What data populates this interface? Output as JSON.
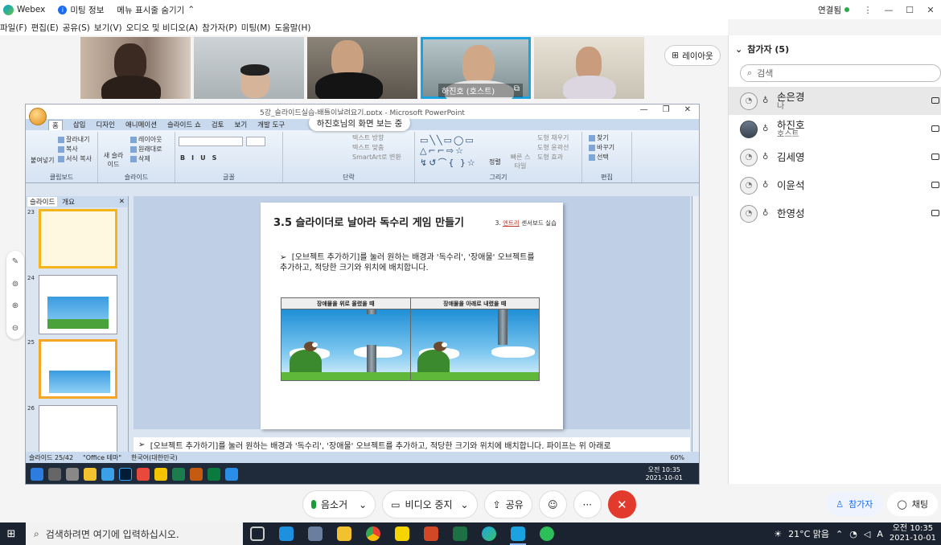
{
  "app": {
    "name": "Webex",
    "meeting_info": "미팅 정보",
    "menu_toggle": "메뉴 표시줄 숨기기",
    "status": "연결됨",
    "colors": {
      "accent": "#1b6cf2",
      "active_tile": "#1aa3e0",
      "leave": "#e23b2e",
      "connected": "#2aa84a"
    }
  },
  "menu": [
    "파일(F)",
    "편집(E)",
    "공유(S)",
    "보기(V)",
    "오디오 및 비디오(A)",
    "참가자(P)",
    "미팅(M)",
    "도움말(H)"
  ],
  "videos": [
    {
      "name": "",
      "active": false
    },
    {
      "name": "",
      "active": false
    },
    {
      "name": "",
      "active": false
    },
    {
      "name": "하진호",
      "role": "(호스트)",
      "active": true
    },
    {
      "name": "",
      "active": false
    }
  ],
  "layout_button": "레이아웃",
  "share": {
    "viewing_badge": "하진호님의 화면 보는 중",
    "ppt": {
      "window_title": "5강_슬라이드실습-배틀이날려요기.pptx - Microsoft PowerPoint",
      "tabs": [
        "홈",
        "삽입",
        "디자인",
        "애니메이션",
        "슬라이드 쇼",
        "검토",
        "보기",
        "개발 도구"
      ],
      "groups": {
        "clipboard": {
          "name": "클립보드",
          "paste": "붙여넣기",
          "cut": "잘라내기",
          "copy": "복사",
          "format": "서식 복사"
        },
        "slides": {
          "name": "슬라이드",
          "new": "새 슬라이드",
          "layout": "레이아웃",
          "reset": "원래대로",
          "delete": "삭제"
        },
        "font": {
          "name": "글꼴"
        },
        "paragraph": {
          "name": "단락",
          "text_dir": "텍스트 방향",
          "align": "텍스트 맞춤",
          "smartart": "SmartArt로 변환"
        },
        "drawing": {
          "name": "그리기",
          "arrange": "정렬",
          "quick": "빠른 스타일",
          "fill": "도형 채우기",
          "outline": "도형 윤곽선",
          "effect": "도형 효과"
        },
        "editing": {
          "name": "편집",
          "find": "찾기",
          "replace": "바꾸기",
          "select": "선택"
        }
      },
      "pane_tabs": [
        "슬라이드",
        "개요"
      ],
      "thumb_numbers": [
        "23",
        "24",
        "25",
        "26"
      ],
      "slide": {
        "title": "3.5 슬라이더로 날아라 독수리 게임 만들기",
        "tag_prefix": "3.",
        "tag_link": "엔트리",
        "tag_suffix": "센서보드 실습",
        "body": "[오브젝트 추가하기]를 눌러 원하는 배경과 '독수리', '장애물' 오브젝트를 추가하고, 적당한 크기와 위치에 배치합니다.",
        "table_headers": [
          "장애물을 위로 올렸을 때",
          "장애물을 아래로 내렸을 때"
        ]
      },
      "notes": "[오브젝트 추가하기]를 눌러 원하는 배경과 '독수리', '장애물' 오브젝트를 추가하고, 적당한 크기와 위치에 배치합니다. 파이프는 위 아래로",
      "status": {
        "slide": "슬라이드 25/42",
        "theme": "\"Office 테마\"",
        "lang": "한국어(대한민국)",
        "zoom": "60%"
      },
      "inner_clock": {
        "time": "오전 10:35",
        "date": "2021-10-01"
      }
    }
  },
  "controls": {
    "mute": "음소거",
    "video": "비디오 중지",
    "share": "공유",
    "more": "···"
  },
  "participants": {
    "header": "참가자 (5)",
    "search_placeholder": "검색",
    "list": [
      {
        "name": "손은경",
        "sub": "나",
        "selected": true,
        "photo": false
      },
      {
        "name": "하진호",
        "sub": "호스트",
        "selected": false,
        "photo": true
      },
      {
        "name": "김세영",
        "sub": "",
        "selected": false,
        "photo": false
      },
      {
        "name": "이윤석",
        "sub": "",
        "selected": false,
        "photo": false
      },
      {
        "name": "한영성",
        "sub": "",
        "selected": false,
        "photo": false
      }
    ],
    "footer_participants": "참가자",
    "footer_chat": "채팅"
  },
  "taskbar": {
    "search_placeholder": "검색하려면 여기에 입력하십시오.",
    "weather": "21°C 맑음",
    "ime": "A",
    "time": "오전 10:35",
    "date": "2021-10-01"
  }
}
